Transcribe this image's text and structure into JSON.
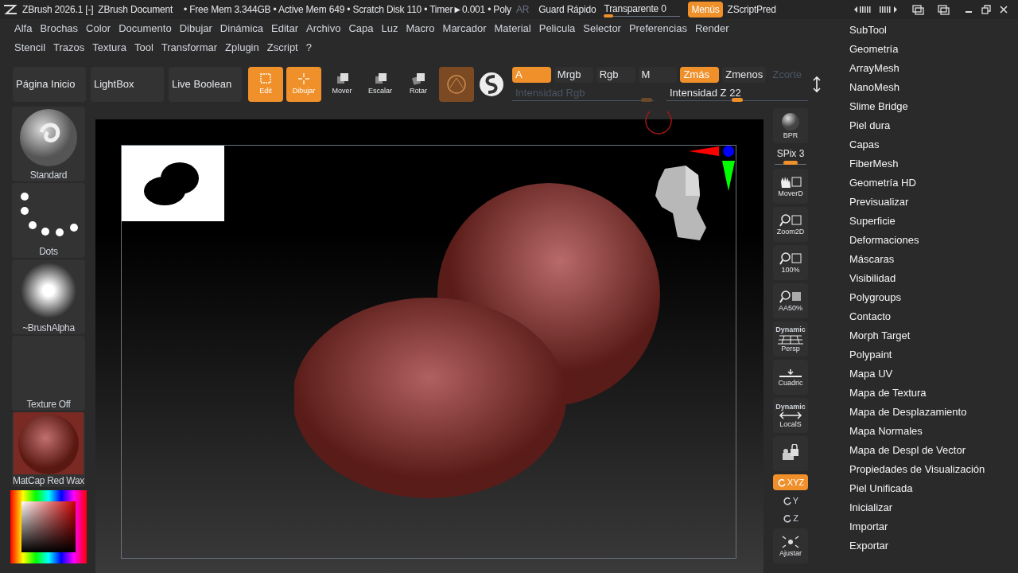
{
  "title_bar": {
    "app": "ZBrush 2026.1 [-]",
    "document": "ZBrush Document",
    "stats": "• Free Mem 3.344GB • Active Mem 649 • Scratch Disk 110 • Timer►0.001 • Poly",
    "ar": {
      "label": "AR",
      "disabled": true
    },
    "quick_save": "Guard Rápido",
    "transparency": {
      "label": "Transparente 0",
      "level": 0.12
    },
    "menus_toggle": {
      "label": "Menús",
      "on": true
    },
    "zscript": "ZScriptPred"
  },
  "menu_row_1": [
    "Alfa",
    "Brochas",
    "Color",
    "Documento",
    "Dibujar",
    "Dinámica",
    "Editar",
    "Archivo",
    "Capa",
    "Luz",
    "Macro",
    "Marcador",
    "Material",
    "Pelicula",
    "Selector",
    "Preferencias",
    "Render"
  ],
  "menu_row_2": [
    "Stencil",
    "Trazos",
    "Textura",
    "Tool",
    "Transformar",
    "Zplugin",
    "Zscript",
    "?"
  ],
  "toolbar": {
    "nav_buttons": [
      "Página Inicio",
      "LightBox",
      "Live Boolean"
    ],
    "tools": [
      {
        "label": "Edit",
        "kind": "edit",
        "selected": true
      },
      {
        "label": "Dibujar",
        "kind": "draw",
        "selected": true
      },
      {
        "label": "Mover",
        "kind": "move",
        "selected": false
      },
      {
        "label": "Escalar",
        "kind": "scale",
        "selected": false
      },
      {
        "label": "Rotar",
        "kind": "rotate",
        "selected": false
      }
    ],
    "rgb_modes": [
      {
        "label": "A",
        "selected": true
      },
      {
        "label": "Mrgb",
        "selected": false
      },
      {
        "label": "Rgb",
        "selected": false
      },
      {
        "label": "M",
        "selected": false
      }
    ],
    "z_modes": [
      {
        "label": "Zmás",
        "selected": true,
        "disabled": false
      },
      {
        "label": "Zmenos",
        "selected": false,
        "disabled": false
      },
      {
        "label": "Zcorte",
        "selected": false,
        "disabled": true
      }
    ],
    "rgb_intensity": {
      "label": "Intensidad Rgb",
      "disabled": true,
      "level": 0.95
    },
    "z_intensity": {
      "label": "Intensidad Z 22",
      "disabled": false,
      "level": 0.5
    }
  },
  "left_shelf": [
    {
      "label": "Standard",
      "kind": "brush"
    },
    {
      "label": "Dots",
      "kind": "stroke"
    },
    {
      "label": "~BrushAlpha",
      "kind": "alpha"
    },
    {
      "label": "Texture Off",
      "kind": "texture"
    },
    {
      "label": "MatCap Red Wax",
      "kind": "material"
    }
  ],
  "right_shelf": [
    {
      "label": "BPR",
      "kind": "bpr",
      "on": false
    },
    {
      "label": "SPix 3",
      "kind": "slider",
      "level": 0.5
    },
    {
      "label": "MoverD",
      "kind": "move",
      "on": false
    },
    {
      "label": "Zoom2D",
      "kind": "zoom",
      "on": false
    },
    {
      "label": "100%",
      "kind": "actual",
      "on": false
    },
    {
      "label": "AA50%",
      "kind": "aa",
      "on": false
    },
    {
      "label": "Persp",
      "kind": "persp",
      "tag": "Dynamic",
      "on": false
    },
    {
      "label": "Cuadric",
      "kind": "floor",
      "on": false
    },
    {
      "label": "LocalS",
      "kind": "local",
      "tag": "Dynamic",
      "on": false
    },
    {
      "kind": "lock",
      "on": false
    },
    {
      "label": "XYZ",
      "kind": "xyz",
      "on": true
    },
    {
      "label": "Y",
      "kind": "axis",
      "on": false
    },
    {
      "label": "Z",
      "kind": "axis",
      "on": false
    },
    {
      "label": "Ajustar",
      "kind": "frame",
      "on": false
    }
  ],
  "palette_menu": [
    "SubTool",
    "Geometría",
    "ArrayMesh",
    "NanoMesh",
    "Slime Bridge",
    "Piel dura",
    "Capas",
    "FiberMesh",
    "Geometría HD",
    "Previsualizar",
    "Superficie",
    "Deformaciones",
    "Máscaras",
    "Visibilidad",
    "Polygroups",
    "Contacto",
    "Morph Target",
    "Polypaint",
    "Mapa UV",
    "Mapa de Textura",
    "Mapa de Desplazamiento",
    "Mapa Normales",
    "Mapa de Despl de Vector",
    "Propiedades de Visualización",
    "Piel Unificada",
    "Inicializar",
    "Importar",
    "Exportar"
  ]
}
